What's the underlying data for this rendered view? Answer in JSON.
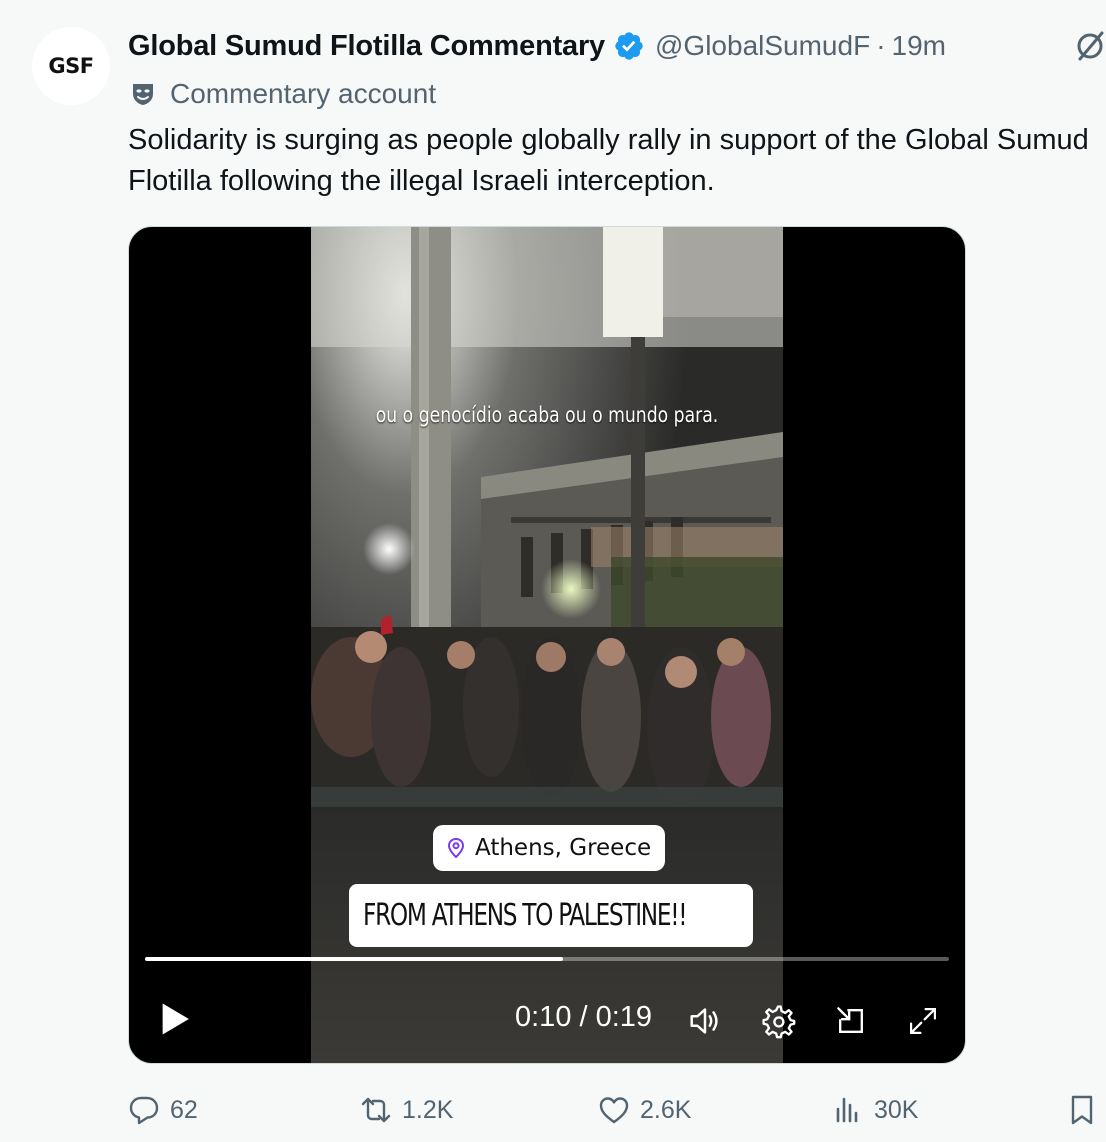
{
  "author": {
    "avatar_text": "GSF",
    "display_name": "Global Sumud Flotilla Commentary",
    "handle": "@GlobalSumudF",
    "separator": "·",
    "time": "19m",
    "label": "Commentary account"
  },
  "tweet_text": {
    "line1": "Solidarity is surging as people globally rally in support of the Global Sumud",
    "line2": "Flotilla following the illegal Israeli interception."
  },
  "video": {
    "subtitle": "ou o genocídio acaba ou o mundo para.",
    "location": "Athens, Greece",
    "caption": "FROM ATHENS TO PALESTINE!!",
    "current_time": "0:10",
    "duration": "0:19",
    "timecode": "0:10 / 0:19",
    "progress_fraction": 0.52
  },
  "actions": {
    "replies": "62",
    "reposts": "1.2K",
    "likes": "2.6K",
    "views": "30K"
  },
  "colors": {
    "verified": "#1d9bf0",
    "secondary_text": "#536471",
    "location_pin": "#7c3aed",
    "page_background": "#f7f9f9"
  },
  "icons": {
    "verified": "verified-badge-icon",
    "grok": "grok-icon",
    "label": "commentary-mask-icon",
    "reply": "reply-icon",
    "repost": "repost-icon",
    "like": "heart-icon",
    "views": "views-icon",
    "bookmark": "bookmark-icon"
  }
}
